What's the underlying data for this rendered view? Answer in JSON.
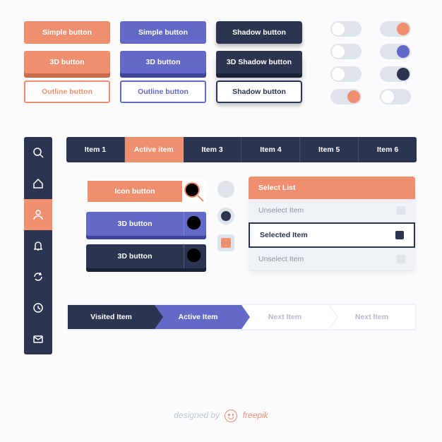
{
  "buttons": {
    "simple": {
      "orange": "Simple button",
      "purple": "Simple button",
      "navy": "Shadow button"
    },
    "threeD": {
      "orange": "3D button",
      "purple": "3D button",
      "navy": "3D Shadow button"
    },
    "outline": {
      "orange": "Outline button",
      "purple": "Outline button",
      "navy": "Shadow button"
    }
  },
  "toggles": [
    {
      "state": "off",
      "color": ""
    },
    {
      "state": "on",
      "color": "orange"
    },
    {
      "state": "off",
      "color": ""
    },
    {
      "state": "on",
      "color": "purple"
    },
    {
      "state": "off",
      "color": ""
    },
    {
      "state": "on",
      "color": "navy"
    },
    {
      "state": "on",
      "color": "orange"
    },
    {
      "state": "off",
      "color": ""
    }
  ],
  "sidebar": [
    "search",
    "home",
    "user",
    "bell",
    "refresh",
    "clock",
    "mail"
  ],
  "sidebar_active_index": 2,
  "tabs": [
    "Item 1",
    "Active item",
    "Item 3",
    "Item 4",
    "Item 5",
    "Item 6"
  ],
  "tabs_active_index": 1,
  "icon_buttons": [
    {
      "variant": "orange",
      "label": "Icon button"
    },
    {
      "variant": "purple3d",
      "label": "3D button"
    },
    {
      "variant": "navy3d",
      "label": "3D button"
    }
  ],
  "radios": [
    {
      "shape": "circle",
      "selected": false
    },
    {
      "shape": "circle",
      "selected": true,
      "color": "navy"
    },
    {
      "shape": "square",
      "selected": true,
      "color": "orange"
    }
  ],
  "select": {
    "title": "Select List",
    "items": [
      {
        "label": "Unselect Item",
        "selected": false
      },
      {
        "label": "Selected Item",
        "selected": true
      },
      {
        "label": "Unselect Item",
        "selected": false
      }
    ]
  },
  "crumbs": [
    {
      "label": "Visited Item",
      "state": "visited"
    },
    {
      "label": "Active Item",
      "state": "active"
    },
    {
      "label": "Next Item",
      "state": "next"
    },
    {
      "label": "Next Item",
      "state": "next"
    }
  ],
  "footer": {
    "prefix": "designed by",
    "brand": "freepik"
  },
  "colors": {
    "orange": "#f08f6f",
    "purple": "#6269c7",
    "navy": "#2b3551"
  }
}
